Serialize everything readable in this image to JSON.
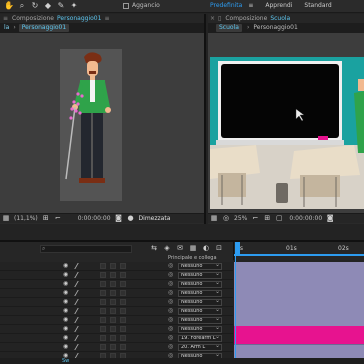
{
  "toolbar": {
    "tools": [
      "pan-tool-icon",
      "zoom-tool-icon",
      "rotate-tool-icon",
      "eraser-tool-icon",
      "brush-tool-icon",
      "puppet-pin-tool-icon"
    ],
    "snap_label": "Aggancio",
    "workspaces": [
      "Predefinita",
      "Apprendi",
      "Standard"
    ]
  },
  "left_panel": {
    "title_prefix": "Composizione",
    "title_name": "Personaggio01",
    "tab_prefix": "la",
    "tab_active": "Personaggio01",
    "zoom": "(11,1%)",
    "timecode": "0:00:00:00",
    "resolution": "Dimezzata"
  },
  "right_panel": {
    "title_prefix": "Composizione",
    "title_name": "Scuola",
    "tab_active": "Scuola",
    "tab_other": "Personaggio01",
    "zoom": "25%",
    "timecode": "0:00:00:00"
  },
  "timeline": {
    "parent_header": "Principale e collega",
    "parents": [
      "Nessuno",
      "Nessuno",
      "Nessuno",
      "Nessuno",
      "Nessuno",
      "Nessuno",
      "Nessuno",
      "Nessuno",
      "19. Forearm L",
      "20. Arm L",
      "Nessuno"
    ],
    "ruler_marks": [
      "0s",
      "01s",
      "02s"
    ],
    "footer": "Sw"
  },
  "colors": {
    "accent": "#2d9cf0",
    "teal": "#1aa2a0",
    "pink_bar": "#e7138f",
    "lavender_bar": "#8e8ab6"
  }
}
